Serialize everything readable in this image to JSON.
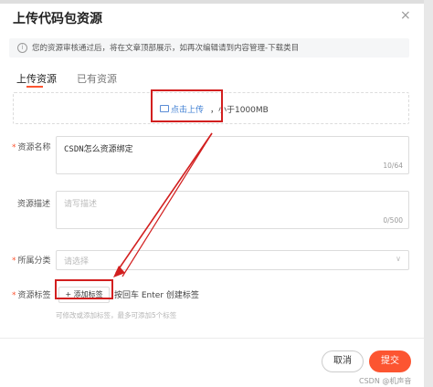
{
  "dialog": {
    "title": "上传代码包资源",
    "close_icon": "×",
    "notice": "您的资源审核通过后，将在文章顶部展示，如再次编辑请到内容管理-下载类目"
  },
  "tabs": [
    {
      "label": "上传资源",
      "active": true
    },
    {
      "label": "已有资源",
      "active": false
    }
  ],
  "upload": {
    "click_text": "点击上传",
    "limit_text": "，小于1000MB"
  },
  "fields": {
    "name": {
      "label": "资源名称",
      "value": "CSDN怎么资源绑定",
      "counter": "10/64"
    },
    "description": {
      "label": "资源描述",
      "placeholder": "请写描述",
      "counter": "0/500"
    },
    "category": {
      "label": "所属分类",
      "placeholder": "请选择"
    },
    "tags": {
      "label": "资源标签",
      "add_button": "+ 添加标签",
      "hint": "按回车 Enter 创建标签",
      "note": "可修改或添加标签，最多可添加5个标签"
    }
  },
  "footer": {
    "cancel": "取消",
    "submit": "提交"
  },
  "watermark": "CSDN @机声音",
  "colors": {
    "accent": "#fc5531",
    "link": "#3f7fd3",
    "annotation": "#d21f1f"
  }
}
